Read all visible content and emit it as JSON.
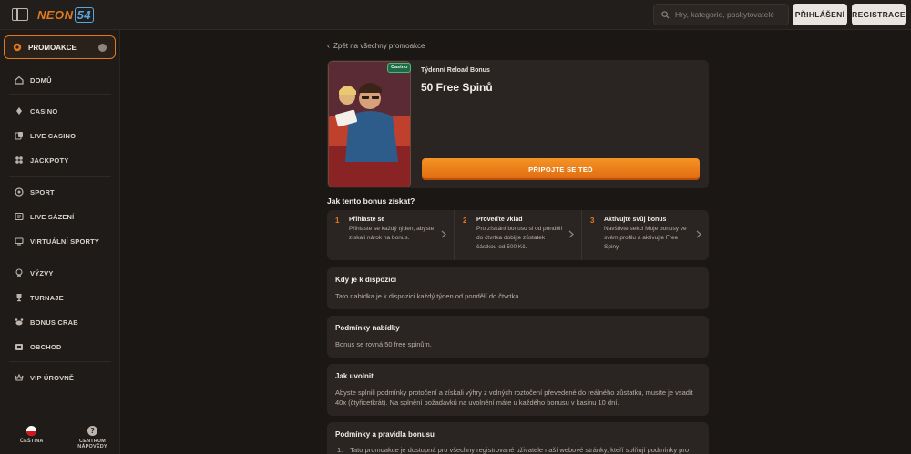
{
  "header": {
    "logo_text": "NEON",
    "logo_num": "54",
    "search_placeholder": "Hry, kategorie, poskytovatelé",
    "login_label": "PŘIHLÁŠENÍ",
    "register_label": "REGISTRACE"
  },
  "sidebar": {
    "promo_label": "PROMOAKCE",
    "items": [
      {
        "label": "DOMŮ",
        "icon": "home-icon"
      },
      {
        "label": "CASINO",
        "icon": "cards-icon"
      },
      {
        "label": "LIVE CASINO",
        "icon": "live-cards-icon"
      },
      {
        "label": "JACKPOTY",
        "icon": "jackpot-icon"
      },
      {
        "label": "SPORT",
        "icon": "ball-icon"
      },
      {
        "label": "LIVE SÁZENÍ",
        "icon": "live-bet-icon"
      },
      {
        "label": "VIRTUÁLNÍ SPORTY",
        "icon": "virtual-icon"
      },
      {
        "label": "VÝZVY",
        "icon": "challenge-icon"
      },
      {
        "label": "TURNAJE",
        "icon": "trophy-icon"
      },
      {
        "label": "BONUS CRAB",
        "icon": "crab-icon"
      },
      {
        "label": "OBCHOD",
        "icon": "shop-icon"
      },
      {
        "label": "VIP ÚROVNĚ",
        "icon": "vip-icon"
      }
    ],
    "footer": {
      "language_label": "ČEŠTINA",
      "help_label": "CENTRUM NÁPOVĚDY"
    }
  },
  "main": {
    "back_label": "Zpět na všechny promoakce",
    "badge": "Casino",
    "kicker": "Týdenní Reload Bonus",
    "title": "50 Free Spinů",
    "join_label": "PŘIPOJTE SE TEĎ",
    "how_title": "Jak tento bonus získat?",
    "steps": [
      {
        "num": "1",
        "title": "Přihlaste se",
        "desc": "Přihlaste se každý týden, abyste získali nárok na bonus."
      },
      {
        "num": "2",
        "title": "Proveďte vklad",
        "desc": "Pro získání bonusu si od pondělí do čtvrtka dobijte zůstatek částkou od 500 Kč."
      },
      {
        "num": "3",
        "title": "Aktivujte svůj bonus",
        "desc": "Navštivte sekci Moje bonusy ve svém profilu a aktivujte Free Spiny"
      }
    ],
    "cards": [
      {
        "title": "Kdy je k dispozici",
        "body": "Tato nabídka je k dispozici každý týden od pondělí do čtvrtka"
      },
      {
        "title": "Podmínky nabídky",
        "body": "Bonus se rovná 50 free spinům."
      },
      {
        "title": "Jak uvolnit",
        "body": "Abyste splnili podmínky protočení a získali výhry z volných roztočení převedené do reálného zůstatku, musíte je vsadit 40x (čtyřicetkrát). Na splnění požadavků na uvolnění máte u každého bonusu v kasinu 10 dní."
      },
      {
        "title": "Podmínky a pravidla bonusu",
        "list_num": "1.",
        "list_text": "Tato promoakce je dostupná pro všechny registrované uživatele naší webové stránky, kteří splňují podmínky pro"
      }
    ]
  },
  "colors": {
    "accent": "#e07a1f",
    "background": "#1a1715",
    "card": "#2a2522"
  }
}
